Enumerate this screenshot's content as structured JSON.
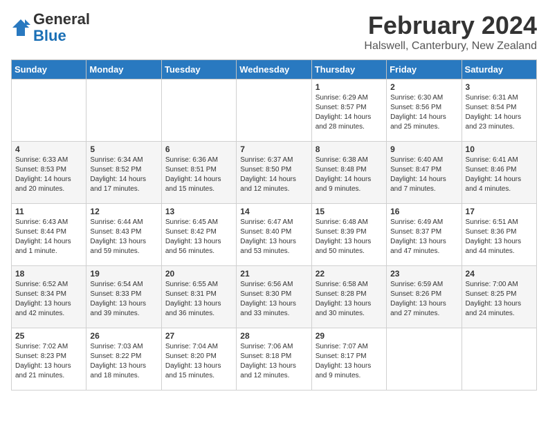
{
  "header": {
    "logo_line1": "General",
    "logo_line2": "Blue",
    "title": "February 2024",
    "subtitle": "Halswell, Canterbury, New Zealand"
  },
  "weekdays": [
    "Sunday",
    "Monday",
    "Tuesday",
    "Wednesday",
    "Thursday",
    "Friday",
    "Saturday"
  ],
  "weeks": [
    [
      {
        "day": "",
        "info": ""
      },
      {
        "day": "",
        "info": ""
      },
      {
        "day": "",
        "info": ""
      },
      {
        "day": "",
        "info": ""
      },
      {
        "day": "1",
        "info": "Sunrise: 6:29 AM\nSunset: 8:57 PM\nDaylight: 14 hours and 28 minutes."
      },
      {
        "day": "2",
        "info": "Sunrise: 6:30 AM\nSunset: 8:56 PM\nDaylight: 14 hours and 25 minutes."
      },
      {
        "day": "3",
        "info": "Sunrise: 6:31 AM\nSunset: 8:54 PM\nDaylight: 14 hours and 23 minutes."
      }
    ],
    [
      {
        "day": "4",
        "info": "Sunrise: 6:33 AM\nSunset: 8:53 PM\nDaylight: 14 hours and 20 minutes."
      },
      {
        "day": "5",
        "info": "Sunrise: 6:34 AM\nSunset: 8:52 PM\nDaylight: 14 hours and 17 minutes."
      },
      {
        "day": "6",
        "info": "Sunrise: 6:36 AM\nSunset: 8:51 PM\nDaylight: 14 hours and 15 minutes."
      },
      {
        "day": "7",
        "info": "Sunrise: 6:37 AM\nSunset: 8:50 PM\nDaylight: 14 hours and 12 minutes."
      },
      {
        "day": "8",
        "info": "Sunrise: 6:38 AM\nSunset: 8:48 PM\nDaylight: 14 hours and 9 minutes."
      },
      {
        "day": "9",
        "info": "Sunrise: 6:40 AM\nSunset: 8:47 PM\nDaylight: 14 hours and 7 minutes."
      },
      {
        "day": "10",
        "info": "Sunrise: 6:41 AM\nSunset: 8:46 PM\nDaylight: 14 hours and 4 minutes."
      }
    ],
    [
      {
        "day": "11",
        "info": "Sunrise: 6:43 AM\nSunset: 8:44 PM\nDaylight: 14 hours and 1 minute."
      },
      {
        "day": "12",
        "info": "Sunrise: 6:44 AM\nSunset: 8:43 PM\nDaylight: 13 hours and 59 minutes."
      },
      {
        "day": "13",
        "info": "Sunrise: 6:45 AM\nSunset: 8:42 PM\nDaylight: 13 hours and 56 minutes."
      },
      {
        "day": "14",
        "info": "Sunrise: 6:47 AM\nSunset: 8:40 PM\nDaylight: 13 hours and 53 minutes."
      },
      {
        "day": "15",
        "info": "Sunrise: 6:48 AM\nSunset: 8:39 PM\nDaylight: 13 hours and 50 minutes."
      },
      {
        "day": "16",
        "info": "Sunrise: 6:49 AM\nSunset: 8:37 PM\nDaylight: 13 hours and 47 minutes."
      },
      {
        "day": "17",
        "info": "Sunrise: 6:51 AM\nSunset: 8:36 PM\nDaylight: 13 hours and 44 minutes."
      }
    ],
    [
      {
        "day": "18",
        "info": "Sunrise: 6:52 AM\nSunset: 8:34 PM\nDaylight: 13 hours and 42 minutes."
      },
      {
        "day": "19",
        "info": "Sunrise: 6:54 AM\nSunset: 8:33 PM\nDaylight: 13 hours and 39 minutes."
      },
      {
        "day": "20",
        "info": "Sunrise: 6:55 AM\nSunset: 8:31 PM\nDaylight: 13 hours and 36 minutes."
      },
      {
        "day": "21",
        "info": "Sunrise: 6:56 AM\nSunset: 8:30 PM\nDaylight: 13 hours and 33 minutes."
      },
      {
        "day": "22",
        "info": "Sunrise: 6:58 AM\nSunset: 8:28 PM\nDaylight: 13 hours and 30 minutes."
      },
      {
        "day": "23",
        "info": "Sunrise: 6:59 AM\nSunset: 8:26 PM\nDaylight: 13 hours and 27 minutes."
      },
      {
        "day": "24",
        "info": "Sunrise: 7:00 AM\nSunset: 8:25 PM\nDaylight: 13 hours and 24 minutes."
      }
    ],
    [
      {
        "day": "25",
        "info": "Sunrise: 7:02 AM\nSunset: 8:23 PM\nDaylight: 13 hours and 21 minutes."
      },
      {
        "day": "26",
        "info": "Sunrise: 7:03 AM\nSunset: 8:22 PM\nDaylight: 13 hours and 18 minutes."
      },
      {
        "day": "27",
        "info": "Sunrise: 7:04 AM\nSunset: 8:20 PM\nDaylight: 13 hours and 15 minutes."
      },
      {
        "day": "28",
        "info": "Sunrise: 7:06 AM\nSunset: 8:18 PM\nDaylight: 13 hours and 12 minutes."
      },
      {
        "day": "29",
        "info": "Sunrise: 7:07 AM\nSunset: 8:17 PM\nDaylight: 13 hours and 9 minutes."
      },
      {
        "day": "",
        "info": ""
      },
      {
        "day": "",
        "info": ""
      }
    ]
  ]
}
